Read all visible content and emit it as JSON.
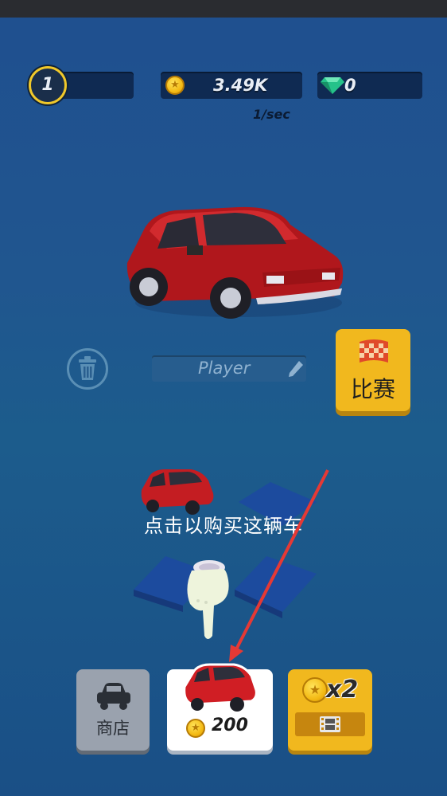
{
  "hud": {
    "level": "1",
    "coins": "3.49K",
    "coin_rate": "1/sec",
    "gems": "0"
  },
  "garage": {
    "player_name": "Player",
    "race_label": "比赛"
  },
  "tutorial": {
    "tip": "点击以购买这辆车"
  },
  "bottom_bar": {
    "shop_label": "商店",
    "buy_price": "200",
    "boost_label": "x2"
  },
  "icons": [
    "trash-icon",
    "pencil-icon",
    "checkered-flag-icon",
    "car-icon",
    "coin-icon",
    "gem-icon",
    "film-icon",
    "pointing-hand-icon"
  ],
  "colors": {
    "accent_yellow": "#f1b81e",
    "car_red": "#c41d22",
    "background_blue": "#1f4f8f",
    "arrow_red": "#e53935"
  }
}
